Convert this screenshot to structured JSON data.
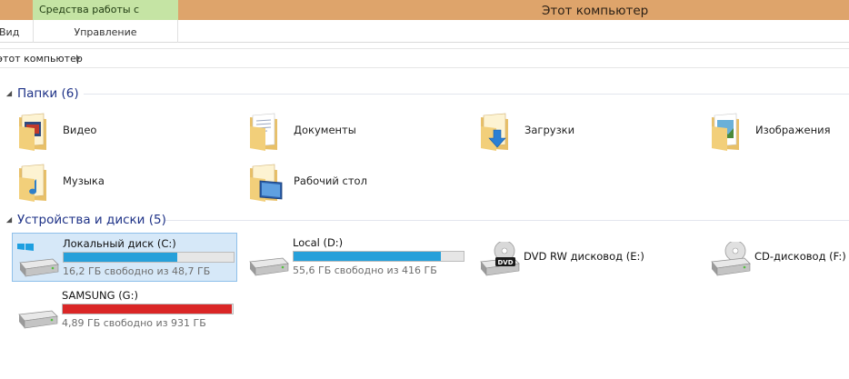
{
  "titlebar": {
    "context_tab": "Средства работы с дисками",
    "window_title": "Этот компьютер"
  },
  "ribbon": {
    "tab_view": "Вид",
    "tab_manage": "Управление"
  },
  "address": {
    "crumb": "этот компьютер"
  },
  "folders_group": {
    "title": "Папки (6)",
    "items": [
      {
        "label": "Видео",
        "icon": "video-folder-icon"
      },
      {
        "label": "Документы",
        "icon": "documents-folder-icon"
      },
      {
        "label": "Загрузки",
        "icon": "downloads-folder-icon"
      },
      {
        "label": "Изображения",
        "icon": "pictures-folder-icon"
      },
      {
        "label": "Музыка",
        "icon": "music-folder-icon"
      },
      {
        "label": "Рабочий стол",
        "icon": "desktop-folder-icon"
      }
    ]
  },
  "devices_group": {
    "title": "Устройства и диски (5)",
    "drives": [
      {
        "label": "Локальный диск (C:)",
        "info": "16,2 ГБ свободно из 48,7 ГБ",
        "used_fraction": 0.667,
        "bar_color": "#26a0da",
        "icon": "system-drive-icon"
      },
      {
        "label": "Local (D:)",
        "info": "55,6 ГБ свободно из 416 ГБ",
        "used_fraction": 0.866,
        "bar_color": "#26a0da",
        "icon": "hard-drive-icon"
      },
      {
        "label": "DVD RW дисковод (E:)",
        "icon": "dvd-drive-icon"
      },
      {
        "label": "CD-дисковод (F:)",
        "icon": "cd-drive-icon"
      },
      {
        "label": "SAMSUNG (G:)",
        "info": "4,89 ГБ свободно из 931 ГБ",
        "used_fraction": 0.995,
        "bar_color": "#da2626",
        "icon": "hard-drive-icon"
      }
    ]
  },
  "colors": {
    "titlebar": "#dea46b",
    "context_tab": "#c5e4a4",
    "group_title": "#1e3287",
    "selection": "#d6e8f8"
  }
}
